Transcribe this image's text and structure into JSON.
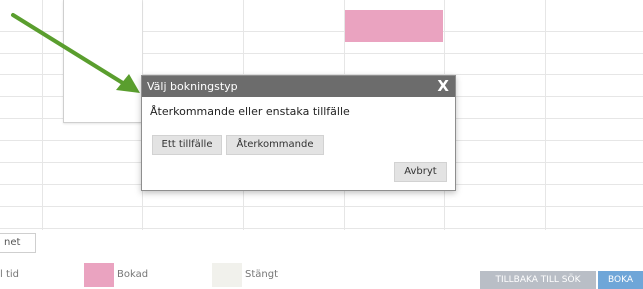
{
  "dialog": {
    "title": "Välj bokningstyp",
    "close_label": "X",
    "question": "Återkommande eller enstaka tillfälle",
    "single_button": "Ett tillfälle",
    "recurring_button": "Återkommande",
    "cancel_button": "Avbryt"
  },
  "filter": {
    "value": "net"
  },
  "legend": {
    "time_label": "l tid",
    "booked_label": "Bokad",
    "closed_label": "Stängt",
    "booked_color": "#eaa3c0",
    "closed_color": "#f1f1ec"
  },
  "actions": {
    "back_button": "TILLBAKA TILL SÖK",
    "book_button": "BOKA"
  },
  "colors": {
    "arrow": "#5a9e2e",
    "dialog_header": "#6c6c6c",
    "booked": "#eaa3c0",
    "back_button": "#b9bec6",
    "book_button": "#6fa6d8"
  }
}
